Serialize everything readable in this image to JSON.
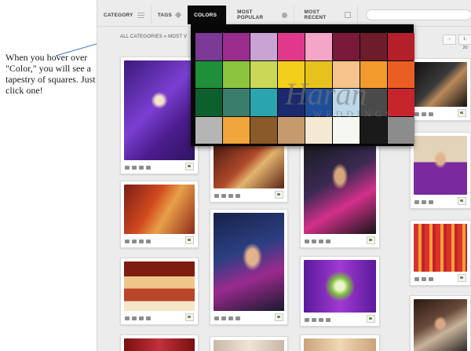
{
  "annotation": {
    "text": "When you hover over \"Color,\" you will see a tapestry of squares. Just click one!"
  },
  "toolbar": {
    "tabs": [
      {
        "label": "CATEGORY"
      },
      {
        "label": "TAGS"
      },
      {
        "label": "COLORS"
      },
      {
        "label": "MOST POPULAR"
      },
      {
        "label": "MOST RECENT"
      }
    ],
    "active_tab": "COLORS",
    "search_placeholder": ""
  },
  "breadcrumb": "ALL CATEGORIES » MOST V",
  "pager": {
    "range": "1-20"
  },
  "palette": {
    "watermark_script": "Haran",
    "watermark_caps": "WEDDINGS",
    "colors": [
      "#7a3a96",
      "#9a2d8e",
      "#c8a3d3",
      "#e0398c",
      "#f4a5c8",
      "#7a1a3b",
      "#6e1b2c",
      "#b3202b",
      "#1f8f3a",
      "#8cc43d",
      "#c9d957",
      "#f1cf1a",
      "#e7c21e",
      "#f6c48c",
      "#f39a2d",
      "#ea5e23",
      "#0e5f2e",
      "#3a7d6c",
      "#2aa5b0",
      "#1b2a6e",
      "#1f4e9b",
      "#bcd8e8",
      "#4a4a4a",
      "#c6252b",
      "#b5b5b5",
      "#f0a63a",
      "#8a5a2b",
      "#c79a6e",
      "#f4e9d3",
      "#f7f7f2",
      "#1a1a1a",
      "#8c8c8c"
    ]
  },
  "accent_colors": {
    "tab_active_bg": "#0a0a0a",
    "stage_bg": "#ececec",
    "annotation_line": "#3a78c8"
  }
}
